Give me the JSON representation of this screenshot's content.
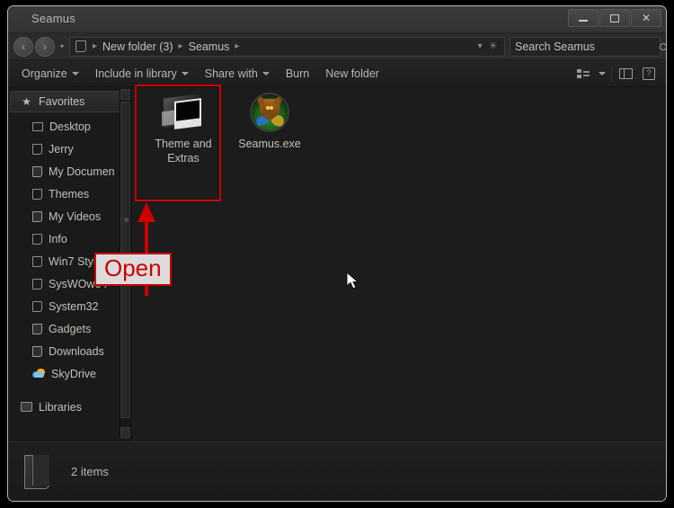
{
  "window": {
    "title": "Seamus",
    "controls": {
      "minimize": "minimize",
      "maximize": "maximize",
      "close": "close"
    }
  },
  "addressbar": {
    "back_glyph": "‹",
    "forward_glyph": "›",
    "recent_glyph": "▾",
    "breadcrumb": [
      "New folder (3)",
      "Seamus"
    ],
    "separator": "▸",
    "dropdown_glyph": "▾",
    "refresh_glyph": "✳"
  },
  "search": {
    "placeholder": "Search Seamus",
    "value": "",
    "icon": "search-icon"
  },
  "toolbar": {
    "items": [
      {
        "label": "Organize",
        "has_caret": true
      },
      {
        "label": "Include in library",
        "has_caret": true
      },
      {
        "label": "Share with",
        "has_caret": true
      },
      {
        "label": "Burn",
        "has_caret": false
      },
      {
        "label": "New folder",
        "has_caret": false
      }
    ],
    "view_icon": "view-options-icon",
    "view_caret": "▾",
    "preview_icon": "preview-pane-icon",
    "help_icon": "help-icon",
    "help_glyph": "?"
  },
  "sidebar": {
    "favorites": {
      "label": "Favorites",
      "icon": "star-icon",
      "glyph": "★"
    },
    "items": [
      {
        "label": "Desktop",
        "icon": "desktop-icon"
      },
      {
        "label": "Jerry",
        "icon": "folder-icon"
      },
      {
        "label": "My Documen",
        "icon": "folder-icon"
      },
      {
        "label": "Themes",
        "icon": "folder-icon"
      },
      {
        "label": "My Videos",
        "icon": "folder-icon"
      },
      {
        "label": "Info",
        "icon": "folder-icon"
      },
      {
        "label": "Win7 Style",
        "icon": "folder-icon"
      },
      {
        "label": "SysWOw64",
        "icon": "folder-icon"
      },
      {
        "label": "System32",
        "icon": "folder-icon"
      },
      {
        "label": "Gadgets",
        "icon": "folder-icon"
      },
      {
        "label": "Downloads",
        "icon": "folder-icon"
      },
      {
        "label": "SkyDrive",
        "icon": "skydrive-icon"
      }
    ],
    "libraries": {
      "label": "Libraries",
      "icon": "library-icon"
    }
  },
  "files": [
    {
      "name": "Theme and Extras",
      "icon": "theme-folder-icon",
      "selected": true
    },
    {
      "name": "Seamus.exe",
      "icon": "seamus-exe-icon",
      "selected": false
    }
  ],
  "annotation": {
    "label": "Open",
    "border_color": "#cc0000",
    "text_color": "#cc0000",
    "background": "#dcdcdc"
  },
  "statusbar": {
    "item_count": "2 items",
    "icon": "folder-icon"
  }
}
